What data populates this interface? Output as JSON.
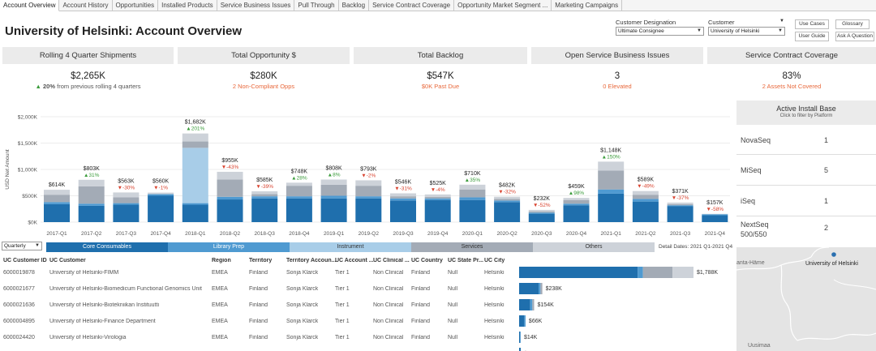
{
  "tabs": [
    "Account Overview",
    "Account History",
    "Opportunities",
    "Installed Products",
    "Service Business Issues",
    "Pull Through",
    "Backlog",
    "Service Contract Coverage",
    "Opportunity Market Segment ...",
    "Marketing Campaigns"
  ],
  "page_title": "University of Helsinki: Account Overview",
  "filters": {
    "designation_label": "Customer Designation",
    "designation_value": "Ultimate Consignee",
    "customer_label": "Customer",
    "customer_value": "University of Helsinki"
  },
  "buttons": {
    "use_cases": "Use Cases",
    "glossary": "Glossary",
    "user_guide": "User Guide",
    "ask": "Ask A Question"
  },
  "kpis": [
    {
      "title": "Rolling 4 Quarter Shipments",
      "value": "$2,265K",
      "sub_prefix": "▲ ",
      "sub_bold": "20%",
      "sub_rest": " from previous rolling 4 quarters"
    },
    {
      "title": "Total Opportunity $",
      "value": "$280K",
      "sub": "2 Non-Compliant Opps"
    },
    {
      "title": "Total Backlog",
      "value": "$547K",
      "sub": "$0K Past Due"
    },
    {
      "title": "Open Service Business Issues",
      "value": "3",
      "sub": "0 Elevated"
    },
    {
      "title": "Service Contract Coverage",
      "value": "83%",
      "sub": "2 Assets Not Covered"
    }
  ],
  "chart_data": {
    "type": "bar",
    "stacked": true,
    "ylabel": "USD Net Amount",
    "yticks": [
      "$0K",
      "$500K",
      "$1,000K",
      "$1,500K",
      "$2,000K"
    ],
    "ylim": [
      0,
      2000
    ],
    "categories": [
      "2017-Q1",
      "2017-Q2",
      "2017-Q3",
      "2017-Q4",
      "2018-Q1",
      "2018-Q2",
      "2018-Q3",
      "2018-Q4",
      "2019-Q1",
      "2019-Q2",
      "2019-Q3",
      "2019-Q4",
      "2020-Q1",
      "2020-Q2",
      "2020-Q3",
      "2020-Q4",
      "2021-Q1",
      "2021-Q2",
      "2021-Q3",
      "2021-Q4"
    ],
    "totals": [
      614,
      803,
      563,
      560,
      1682,
      955,
      585,
      748,
      808,
      793,
      546,
      525,
      710,
      482,
      232,
      459,
      1148,
      589,
      371,
      157
    ],
    "total_labels": [
      "$614K",
      "$803K",
      "$563K",
      "$560K",
      "$1,682K",
      "$955K",
      "$585K",
      "$748K",
      "$808K",
      "$793K",
      "$546K",
      "$525K",
      "$710K",
      "$482K",
      "$232K",
      "$459K",
      "$1,148K",
      "$589K",
      "$371K",
      "$157K"
    ],
    "changes": [
      "",
      "▲31%",
      "▼-30%",
      "▼-1%",
      "▲201%",
      "▼-43%",
      "▼-39%",
      "▲28%",
      "▲8%",
      "▼-2%",
      "▼-31%",
      "▼-4%",
      "▲35%",
      "▼-32%",
      "▼-52%",
      "▲98%",
      "▲150%",
      "▼-49%",
      "▼-37%",
      "▼-58%"
    ],
    "series": [
      {
        "name": "Core Consumables",
        "color": "#1f6fad",
        "values": [
          340,
          310,
          330,
          500,
          330,
          430,
          450,
          450,
          450,
          450,
          410,
          420,
          420,
          380,
          160,
          320,
          540,
          390,
          300,
          130
        ]
      },
      {
        "name": "Library Prep",
        "color": "#4f9ad1",
        "values": [
          40,
          40,
          30,
          30,
          30,
          50,
          40,
          40,
          50,
          40,
          40,
          30,
          50,
          30,
          20,
          30,
          80,
          50,
          20,
          20
        ]
      },
      {
        "name": "Instrument",
        "color": "#a8cde8",
        "values": [
          0,
          0,
          0,
          0,
          1050,
          0,
          0,
          0,
          0,
          0,
          0,
          0,
          0,
          0,
          0,
          0,
          0,
          0,
          0,
          0
        ]
      },
      {
        "name": "Services",
        "color": "#a3abb6",
        "values": [
          140,
          330,
          110,
          0,
          120,
          330,
          40,
          200,
          210,
          200,
          40,
          30,
          150,
          30,
          20,
          70,
          360,
          80,
          20,
          0
        ]
      },
      {
        "name": "Others",
        "color": "#cdd2d9",
        "values": [
          94,
          123,
          93,
          30,
          152,
          145,
          55,
          58,
          98,
          103,
          56,
          45,
          90,
          42,
          32,
          39,
          168,
          69,
          31,
          7
        ]
      }
    ]
  },
  "legend_colors": {
    "Core Consumables": "#1f6fad",
    "Library Prep": "#4f9ad1",
    "Instrument": "#a8cde8",
    "Services": "#a3abb6",
    "Others": "#cdd2d9"
  },
  "quarter_select": "Quarterly",
  "detail_dates": "Detail Dates: 2021 Q1-2021 Q4",
  "table": {
    "columns": [
      "UC Customer ID",
      "UC Customer",
      "Region",
      "Territory",
      "Territory Accoun...",
      "UC Account ...",
      "UC Clinical ...",
      "UC Country",
      "UC State Pr...",
      "UC City"
    ],
    "rows": [
      {
        "cells": [
          "6000019878",
          "University of Helsinki-FIMM",
          "EMEA",
          "Finland",
          "Sonja Klarck",
          "Tier 1",
          "Non Clinical",
          "Finland",
          "Null",
          "Helsinki"
        ],
        "amount": "$1,788K",
        "value": 1788,
        "mix": [
          0.68,
          0.03,
          0,
          0.17,
          0.12
        ]
      },
      {
        "cells": [
          "6000021677",
          "University of Helsinki-Biomedicum Functional Genomics Unit",
          "EMEA",
          "Finland",
          "Sonja Klarck",
          "Tier 1",
          "Non Clinical",
          "Finland",
          "Null",
          "Helsinki"
        ],
        "amount": "$238K",
        "value": 238,
        "mix": [
          0.84,
          0.08,
          0,
          0.08,
          0
        ]
      },
      {
        "cells": [
          "6000021636",
          "University of Helsinki-Biotekniikan Instituutti",
          "EMEA",
          "Finland",
          "Sonja Klarck",
          "Tier 1",
          "Non Clinical",
          "Finland",
          "Null",
          "Helsinki"
        ],
        "amount": "$154K",
        "value": 154,
        "mix": [
          0.74,
          0.14,
          0,
          0.12,
          0
        ]
      },
      {
        "cells": [
          "6000004895",
          "University of Helsinki-Finance Department",
          "EMEA",
          "Finland",
          "Sonja Klarck",
          "Tier 1",
          "Non Clinical",
          "Finland",
          "Null",
          "Helsinki"
        ],
        "amount": "$66K",
        "value": 66,
        "mix": [
          0.8,
          0.2,
          0,
          0,
          0
        ]
      },
      {
        "cells": [
          "6000024420",
          "University of Helsinki-Virologia",
          "EMEA",
          "Finland",
          "Sonja Klarck",
          "Tier 1",
          "Non Clinical",
          "Finland",
          "Null",
          "Helsinki"
        ],
        "amount": "$14K",
        "value": 14,
        "mix": [
          0.6,
          0.4,
          0,
          0,
          0
        ]
      },
      {
        "cells": [
          "6000023102",
          "University of Helsinki",
          "EMEA",
          "Finland",
          "Sonja Klarck",
          "Tier 1",
          "Non Clinical",
          "Finland",
          "Null",
          "Helsinki"
        ],
        "amount": "$6K",
        "value": 6,
        "mix": [
          1,
          0,
          0,
          0,
          0
        ]
      }
    ]
  },
  "install_base": {
    "title": "Active Install Base",
    "subtitle": "Click to filter by Platform",
    "items": [
      {
        "platform": "NovaSeq",
        "count": "1"
      },
      {
        "platform": "MiSeq",
        "count": "5"
      },
      {
        "platform": "iSeq",
        "count": "1"
      },
      {
        "platform": "NextSeq 500/550",
        "count": "2"
      }
    ]
  },
  "map": {
    "labels": [
      "University of Helsinki",
      "anta-Häme",
      "Uusimaa"
    ]
  }
}
